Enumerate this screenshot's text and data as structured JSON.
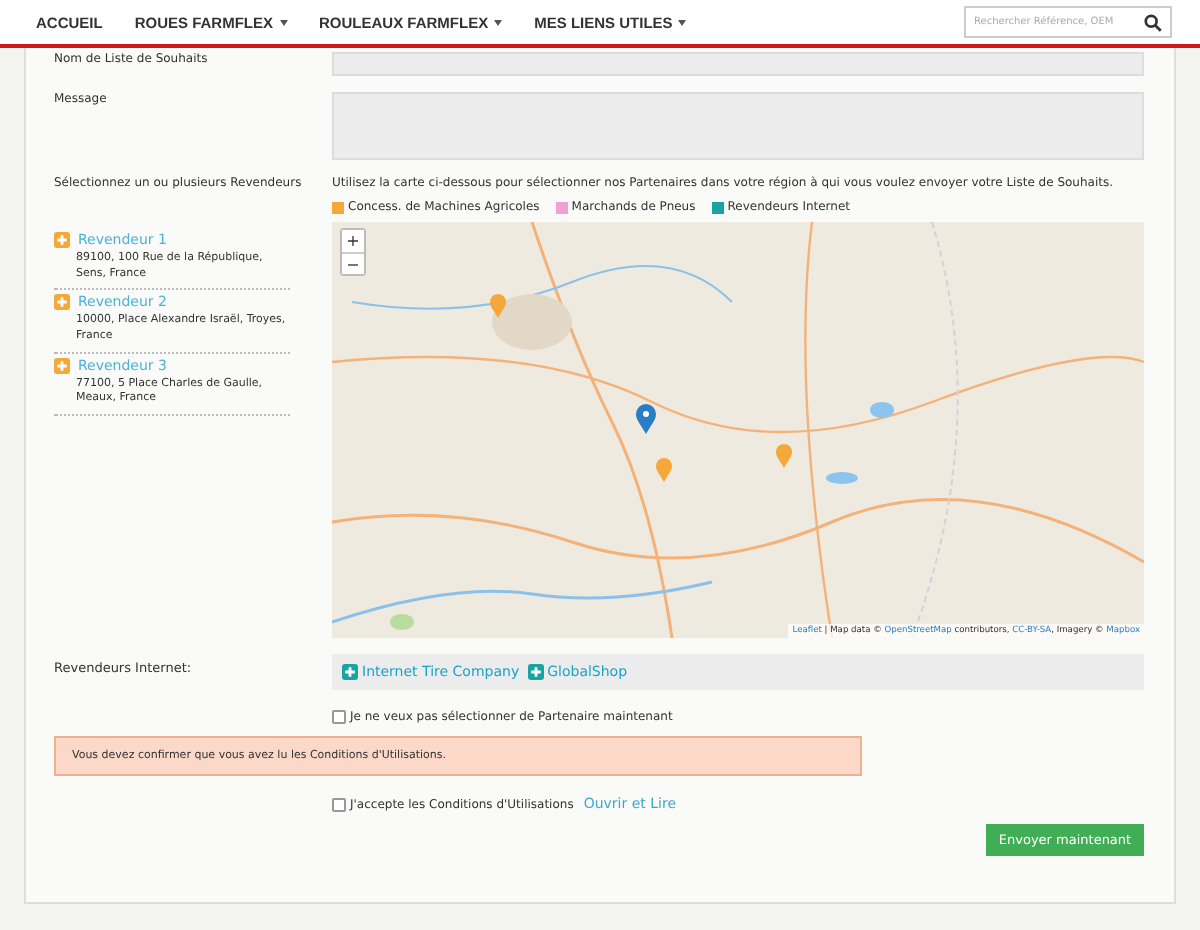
{
  "nav": {
    "items": [
      {
        "label": "ACCUEIL",
        "dropdown": false
      },
      {
        "label": "ROUES FARMFLEX",
        "dropdown": true
      },
      {
        "label": "ROULEAUX FARMFLEX",
        "dropdown": true
      },
      {
        "label": "MES LIENS UTILES",
        "dropdown": true
      }
    ],
    "search": {
      "placeholder": "Rechercher Référence, OEM"
    }
  },
  "form": {
    "name_label": "Nom de Liste de Souhaits",
    "message_label": "Message",
    "dealers_label": "Sélectionnez un ou plusieurs Revendeurs",
    "map_hint": "Utilisez la carte ci-dessous pour sélectionner nos Partenaires dans votre région à qui vous voulez envoyer votre Liste de Souhaits.",
    "legend": [
      {
        "label": "Concess. de Machines Agricoles",
        "color": "#f5a83a"
      },
      {
        "label": "Marchands de Pneus",
        "color": "#f4a0d8"
      },
      {
        "label": "Revendeurs Internet",
        "color": "#1aa3a3"
      }
    ],
    "dealers": [
      {
        "name": "Revendeur 1",
        "address": "89100, 100 Rue de la République, Sens, France"
      },
      {
        "name": "Revendeur 2",
        "address": "10000, Place Alexandre Israël, Troyes, France"
      },
      {
        "name": "Revendeur 3",
        "address": "77100, 5 Place Charles de Gaulle, Meaux, France"
      }
    ],
    "map": {
      "zoom_in": "+",
      "zoom_out": "−",
      "attribution": [
        {
          "text": "Leaflet",
          "link": true
        },
        {
          "text": " | Map data © ",
          "link": false
        },
        {
          "text": "OpenStreetMap",
          "link": true
        },
        {
          "text": " contributors, ",
          "link": false
        },
        {
          "text": "CC-BY-SA",
          "link": true
        },
        {
          "text": ", Imagery © ",
          "link": false
        },
        {
          "text": "Mapbox",
          "link": true
        }
      ]
    },
    "internet_label": "Revendeurs Internet:",
    "internet_dealers": [
      "Internet Tire Company",
      "GlobalShop"
    ],
    "no_partner": {
      "label": "Je ne veux pas sélectionner de Partenaire maintenant",
      "checked": false
    },
    "alert": "Vous devez confirmer que vous avez lu les Conditions d'Utilisations.",
    "accept": {
      "label": "J'accepte les Conditions d'Utilisations",
      "link": "Ouvrir et Lire",
      "checked": false
    },
    "submit": "Envoyer maintenant"
  }
}
